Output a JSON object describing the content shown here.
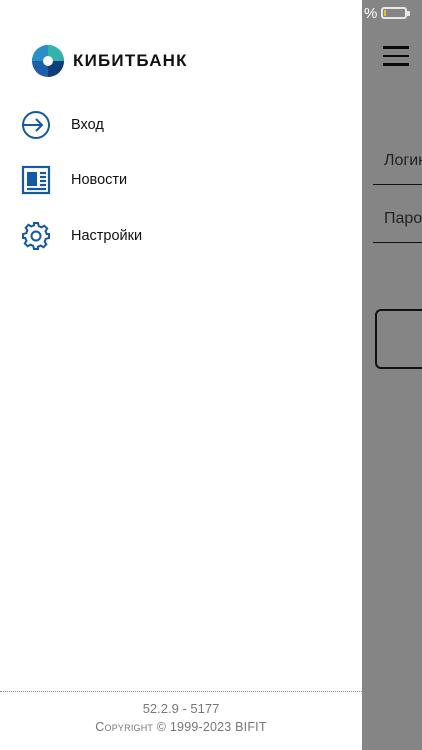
{
  "status_bar": {
    "battery_percent_text": "%",
    "battery_level": 0.1,
    "battery_color": "#e2c21e",
    "battery_icon": "battery-icon"
  },
  "background_screen": {
    "login_placeholder": "Логин",
    "password_placeholder": "Пароль"
  },
  "drawer": {
    "brand": {
      "name": "КИБИТБАНК",
      "colors": {
        "teal": "#34b3a8",
        "blue": "#1a5fa8",
        "dark_blue": "#0e3f7a"
      }
    },
    "menu": [
      {
        "label": "Вход",
        "icon": "login-arrow-icon"
      },
      {
        "label": "Новости",
        "icon": "newspaper-icon"
      },
      {
        "label": "Настройки",
        "icon": "gear-icon"
      }
    ],
    "icon_color": "#1558a3",
    "footer": {
      "version": "52.2.9 - 5177",
      "copyright": "Copyright © 1999-2023 BIFIT"
    }
  }
}
